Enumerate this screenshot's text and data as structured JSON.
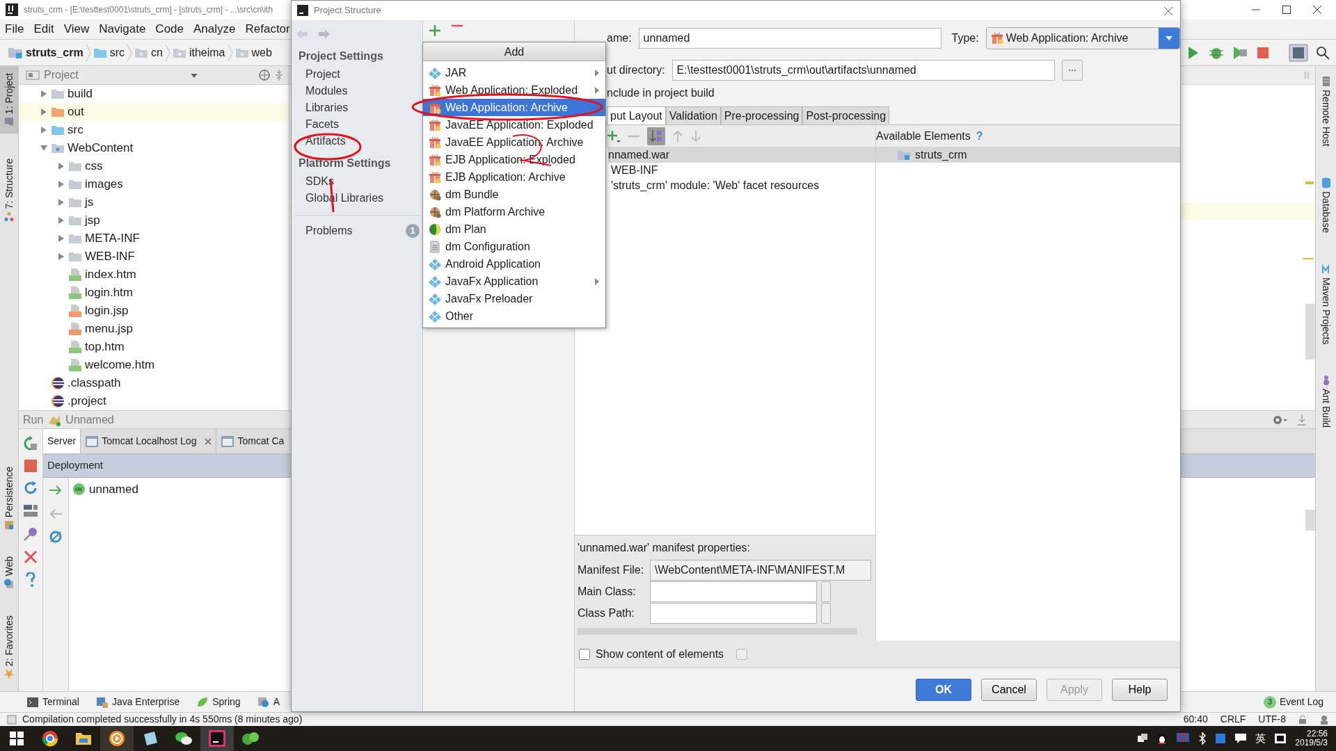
{
  "ide": {
    "title": "struts_crm - [E:\\testtest0001\\struts_crm] - [struts_crm] - ...\\src\\cn\\ith",
    "menu": [
      "File",
      "Edit",
      "View",
      "Navigate",
      "Code",
      "Analyze",
      "Refactor"
    ],
    "breadcrumb": [
      {
        "label": "struts_crm",
        "kind": "module"
      },
      {
        "label": "src",
        "kind": "source"
      },
      {
        "label": "cn",
        "kind": "package"
      },
      {
        "label": "itheima",
        "kind": "package"
      },
      {
        "label": "web",
        "kind": "package"
      }
    ],
    "left_strip": [
      {
        "label": "1: Project",
        "selected": true
      },
      {
        "label": "7: Structure",
        "selected": false
      }
    ],
    "left_strip_bottom": [
      "Persistence",
      "Web",
      "2: Favorites"
    ],
    "project_panel": {
      "title": "Project",
      "tree": [
        {
          "label": "build",
          "kind": "folder",
          "expanded": false,
          "highlighted": false
        },
        {
          "label": "out",
          "kind": "excluded",
          "expanded": false,
          "highlighted": true
        },
        {
          "label": "src",
          "kind": "source",
          "expanded": false,
          "highlighted": false
        },
        {
          "label": "WebContent",
          "kind": "web",
          "expanded": true,
          "highlighted": false,
          "children": [
            {
              "label": "css",
              "kind": "folder",
              "expanded": false,
              "highlighted": false
            },
            {
              "label": "images",
              "kind": "folder",
              "expanded": false,
              "highlighted": false
            },
            {
              "label": "js",
              "kind": "folder",
              "expanded": false,
              "highlighted": false
            },
            {
              "label": "jsp",
              "kind": "folder",
              "expanded": false,
              "highlighted": false
            },
            {
              "label": "META-INF",
              "kind": "folder",
              "expanded": false,
              "highlighted": false
            },
            {
              "label": "WEB-INF",
              "kind": "folder",
              "expanded": false,
              "highlighted": false
            },
            {
              "label": "index.htm",
              "kind": "html",
              "highlighted": false
            },
            {
              "label": "login.htm",
              "kind": "html",
              "highlighted": false
            },
            {
              "label": "login.jsp",
              "kind": "jsp",
              "highlighted": false
            },
            {
              "label": "menu.jsp",
              "kind": "jsp",
              "highlighted": false
            },
            {
              "label": "top.htm",
              "kind": "html",
              "highlighted": false
            },
            {
              "label": "welcome.htm",
              "kind": "html",
              "highlighted": false
            }
          ]
        },
        {
          "label": ".classpath",
          "kind": "eclipse",
          "highlighted": false
        },
        {
          "label": ".project",
          "kind": "eclipse",
          "highlighted": false
        }
      ]
    },
    "run_panel": {
      "title": "Run",
      "config": "Unnamed",
      "tabs": [
        {
          "label": "Server",
          "selected": true,
          "closable": false
        },
        {
          "label": "Tomcat Localhost Log",
          "selected": false,
          "closable": true
        },
        {
          "label": "Tomcat Ca",
          "selected": false,
          "closable": false
        }
      ],
      "deployment_header": "Deployment",
      "deployments": [
        {
          "name": "unnamed",
          "status": "OK"
        }
      ]
    },
    "tool_tabs": [
      {
        "label": "Terminal",
        "kind": "terminal"
      },
      {
        "label": "Java Enterprise",
        "kind": "javaee"
      },
      {
        "label": "Spring",
        "kind": "spring"
      },
      {
        "label": "A",
        "kind": "web"
      }
    ],
    "right_strip": [
      {
        "label": "Remote Host",
        "kind": "host"
      },
      {
        "label": "Database",
        "kind": "database"
      },
      {
        "label": "Maven Projects",
        "kind": "maven"
      },
      {
        "label": "Ant Build",
        "kind": "ant"
      }
    ],
    "event_log": {
      "count": "3",
      "label": "Event Log"
    },
    "status": {
      "message": "Compilation completed successfully in 4s 550ms (8 minutes ago)",
      "position": "60:40",
      "line_separator": "CRLF",
      "encoding": "UTF-8"
    }
  },
  "dialog": {
    "title": "Project Structure",
    "nav": [
      {
        "heading": "Project Settings",
        "items": [
          "Project",
          "Modules",
          "Libraries",
          "Facets",
          "Artifacts"
        ]
      },
      {
        "heading": "Platform Settings",
        "items": [
          "SDKs",
          "Global Libraries"
        ]
      }
    ],
    "problems": {
      "label": "Problems",
      "count": "1"
    },
    "add_menu": {
      "title": "Add",
      "items": [
        {
          "label": "JAR",
          "kind": "diamond",
          "submenu": true,
          "selected": false
        },
        {
          "label": "Web Application: Exploded",
          "kind": "gift",
          "submenu": true,
          "selected": false
        },
        {
          "label": "Web Application: Archive",
          "kind": "gift",
          "submenu": false,
          "selected": true
        },
        {
          "label": "JavaEE Application: Exploded",
          "kind": "gift",
          "submenu": false,
          "selected": false
        },
        {
          "label": "JavaEE Application: Archive",
          "kind": "gift",
          "submenu": false,
          "selected": false
        },
        {
          "label": "EJB Application: Exploded",
          "kind": "gift",
          "submenu": false,
          "selected": false
        },
        {
          "label": "EJB Application: Archive",
          "kind": "gift",
          "submenu": false,
          "selected": false
        },
        {
          "label": "dm Bundle",
          "kind": "globe",
          "submenu": false,
          "selected": false
        },
        {
          "label": "dm Platform Archive",
          "kind": "globe",
          "submenu": false,
          "selected": false
        },
        {
          "label": "dm Plan",
          "kind": "sphere",
          "submenu": false,
          "selected": false
        },
        {
          "label": "dm Configuration",
          "kind": "document",
          "submenu": false,
          "selected": false
        },
        {
          "label": "Android Application",
          "kind": "diamond",
          "submenu": false,
          "selected": false
        },
        {
          "label": "JavaFx Application",
          "kind": "diamond",
          "submenu": true,
          "selected": false
        },
        {
          "label": "JavaFx Preloader",
          "kind": "diamond",
          "submenu": false,
          "selected": false
        },
        {
          "label": "Other",
          "kind": "diamond",
          "submenu": false,
          "selected": false
        }
      ]
    },
    "name": {
      "label": "ame:",
      "value": "unnamed"
    },
    "type": {
      "label": "Type:",
      "value": "Web Application: Archive"
    },
    "output_directory": {
      "label": "ut directory:",
      "value": "E:\\testtest0001\\struts_crm\\out\\artifacts\\unnamed"
    },
    "include_in_build": {
      "label": "nclude in project build"
    },
    "tabs": [
      {
        "label": "put Layout",
        "selected": true
      },
      {
        "label": "Validation",
        "selected": false
      },
      {
        "label": "Pre-processing",
        "selected": false
      },
      {
        "label": "Post-processing",
        "selected": false
      }
    ],
    "layout_tree": [
      {
        "label": "nnamed.war",
        "selected": true
      },
      {
        "label": "WEB-INF",
        "selected": false
      },
      {
        "label": "'struts_crm' module: 'Web' facet resources",
        "selected": false
      }
    ],
    "available": {
      "title": "Available Elements",
      "help": "?",
      "items": [
        {
          "label": "struts_crm",
          "selected": true
        }
      ]
    },
    "manifest": {
      "title": "'unnamed.war' manifest properties:",
      "fields": [
        {
          "label": "Manifest File:",
          "value": "\\WebContent\\META-INF\\MANIFEST.M",
          "browse": false
        },
        {
          "label": "Main Class:",
          "browse": true
        },
        {
          "label": "Class Path:",
          "browse": true
        }
      ]
    },
    "show_content": {
      "label": "Show content of elements",
      "checked": false
    },
    "buttons": [
      {
        "label": "OK",
        "kind": "primary"
      },
      {
        "label": "Cancel",
        "kind": "default"
      },
      {
        "label": "Apply",
        "kind": "disabled"
      },
      {
        "label": "Help",
        "kind": "default"
      }
    ]
  },
  "taskbar": {
    "ime": "英",
    "time": "22:56",
    "date": "2019/5/3"
  }
}
